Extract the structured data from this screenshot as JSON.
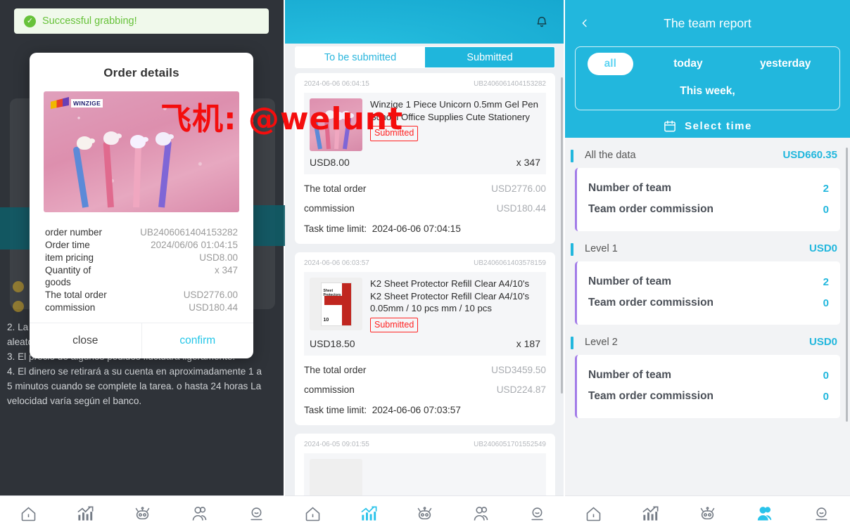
{
  "watermark": {
    "text": "飞机: @welunt",
    "color": "#f40d0d"
  },
  "theme": {
    "accent": "#22b7dd",
    "accent_light": "#5ed4f2",
    "success": "#67c23a",
    "danger": "#ff2222",
    "purple": "#a37ce8"
  },
  "panel_left": {
    "toast": {
      "text": "Successful grabbing!",
      "icon": "check-circle-icon"
    },
    "modal": {
      "title": "Order details",
      "product_brand": "WINZIGE",
      "rows": [
        {
          "label": "order number",
          "value": "UB2406061404153282"
        },
        {
          "label": "Order time",
          "value": "2024/06/06 01:04:15"
        },
        {
          "label": "item pricing",
          "value": "USD8.00"
        },
        {
          "label": "Quantity of goods",
          "value": "x 347"
        },
        {
          "label": "The total order",
          "value": "USD2776.00"
        },
        {
          "label": "commission",
          "value": "USD180.44"
        }
      ],
      "close_label": "close",
      "confirm_label": "confirm"
    },
    "background_text": "2. La comisión de cada pedido será asignada\naleatoriamente por el sistema.\n3. El precio de algunos pedidos fluctuará ligeramente.\n4. El dinero se retirará a su cuenta en aproximadamente 1 a\n5 minutos cuando se complete la tarea. o hasta 24 horas La\nvelocidad varía según el banco."
  },
  "panel_middle": {
    "bell_icon": "bell-icon",
    "tabs": [
      {
        "label": "To be submitted",
        "active": true
      },
      {
        "label": "Submitted",
        "active": false
      }
    ],
    "orders": [
      {
        "timestamp": "2024-06-06 06:04:15",
        "order_number": "UB2406061404153282",
        "title": "Winzige 1 Piece Unicorn 0.5mm Gel Pen School Office Supplies Cute Stationery",
        "status": "Submitted",
        "unit_price": "USD8.00",
        "quantity": "x 347",
        "total_label": "The total order",
        "total_value": "USD2776.00",
        "commission_label": "commission",
        "commission_value": "USD180.44",
        "time_limit_label": "Task time limit:",
        "time_limit_value": "2024-06-06 07:04:15",
        "thumb": "unicorn-gel-pens"
      },
      {
        "timestamp": "2024-06-06 06:03:57",
        "order_number": "UB2406061403578159",
        "title": "K2 Sheet Protector Refill Clear A4/10's K2 Sheet Protector Refill Clear A4/10's 0.05mm / 10 pcs mm / 10 pcs",
        "status": "Submitted",
        "unit_price": "USD18.50",
        "quantity": "x 187",
        "total_label": "The total order",
        "total_value": "USD3459.50",
        "commission_label": "commission",
        "commission_value": "USD224.87",
        "time_limit_label": "Task time limit:",
        "time_limit_value": "2024-06-06 07:03:57",
        "thumb": "sheet-protector-box"
      },
      {
        "timestamp": "2024-06-05 09:01:55",
        "order_number": "UB2406051701552549",
        "title": "",
        "status": "",
        "unit_price": "",
        "quantity": "",
        "total_label": "",
        "total_value": "",
        "commission_label": "",
        "commission_value": "",
        "time_limit_label": "",
        "time_limit_value": "",
        "thumb": "partial"
      }
    ]
  },
  "panel_right": {
    "header": {
      "title": "The team report",
      "back_icon": "chevron-left-icon"
    },
    "filters": [
      {
        "label": "all",
        "active": true
      },
      {
        "label": "today",
        "active": false
      },
      {
        "label": "yesterday",
        "active": false
      },
      {
        "label": "This week,",
        "active": false
      }
    ],
    "select_time": {
      "label": "Select time",
      "icon": "calendar-icon"
    },
    "sections": [
      {
        "title": "All the data",
        "amount": "USD660.35",
        "rows": [
          {
            "label": "Number of team",
            "value": "2"
          },
          {
            "label": "Team order commission",
            "value": "0"
          }
        ]
      },
      {
        "title": "Level 1",
        "amount": "USD0",
        "rows": [
          {
            "label": "Number of team",
            "value": "2"
          },
          {
            "label": "Team order commission",
            "value": "0"
          }
        ]
      },
      {
        "title": "Level 2",
        "amount": "USD0",
        "rows": [
          {
            "label": "Number of team",
            "value": "0"
          },
          {
            "label": "Team order commission",
            "value": "0"
          }
        ]
      }
    ]
  },
  "bottom_nav": {
    "items": [
      {
        "icon": "home-icon",
        "active": false
      },
      {
        "icon": "chart-icon",
        "active": false
      },
      {
        "icon": "robot-icon",
        "active": false
      },
      {
        "icon": "team-icon",
        "active": false
      },
      {
        "icon": "profile-icon",
        "active": false
      }
    ],
    "active_index_left": -1,
    "active_index_middle": 1,
    "active_index_right": 3
  }
}
